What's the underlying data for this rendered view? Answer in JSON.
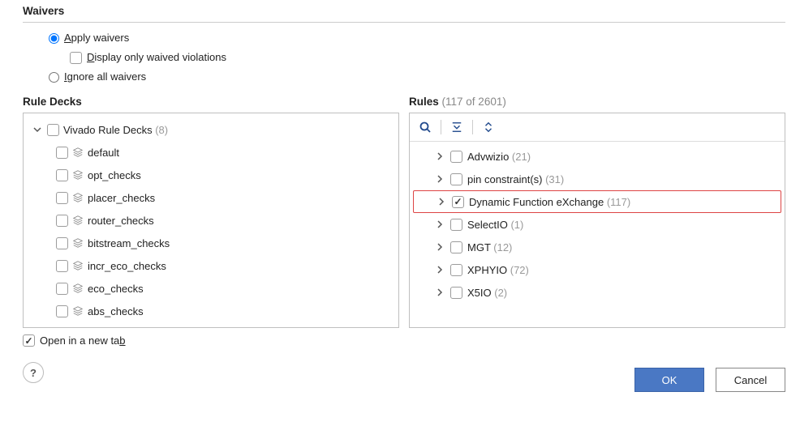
{
  "waivers": {
    "title": "Waivers",
    "apply": {
      "label_pre": "A",
      "label_post": "pply waivers",
      "checked": true
    },
    "display_only": {
      "label_pre": "D",
      "label_post": "isplay only waived violations",
      "checked": false
    },
    "ignore_all": {
      "label_pre": "I",
      "label_post": "gnore all waivers",
      "checked": false
    }
  },
  "rule_decks": {
    "title": "Rule Decks",
    "root": {
      "label": "Vivado Rule Decks",
      "count": "(8)"
    },
    "items": [
      {
        "label": "default"
      },
      {
        "label": "opt_checks"
      },
      {
        "label": "placer_checks"
      },
      {
        "label": "router_checks"
      },
      {
        "label": "bitstream_checks"
      },
      {
        "label": "incr_eco_checks"
      },
      {
        "label": "eco_checks"
      },
      {
        "label": "abs_checks"
      }
    ]
  },
  "rules": {
    "title": "Rules",
    "count": "(117 of 2601)",
    "items": [
      {
        "label": "Advwizio",
        "count": "(21)",
        "checked": false,
        "highlight": false
      },
      {
        "label": "pin constraint(s)",
        "count": "(31)",
        "checked": false,
        "highlight": false
      },
      {
        "label": "Dynamic Function eXchange",
        "count": "(117)",
        "checked": true,
        "highlight": true
      },
      {
        "label": "SelectIO",
        "count": "(1)",
        "checked": false,
        "highlight": false
      },
      {
        "label": "MGT",
        "count": "(12)",
        "checked": false,
        "highlight": false
      },
      {
        "label": "XPHYIO",
        "count": "(72)",
        "checked": false,
        "highlight": false
      },
      {
        "label": "X5IO",
        "count": "(2)",
        "checked": false,
        "highlight": false
      }
    ]
  },
  "open_tab": {
    "label_pre": "Open in a new ta",
    "label_post": "b",
    "checked": true
  },
  "buttons": {
    "ok": "OK",
    "cancel": "Cancel",
    "help": "?"
  }
}
